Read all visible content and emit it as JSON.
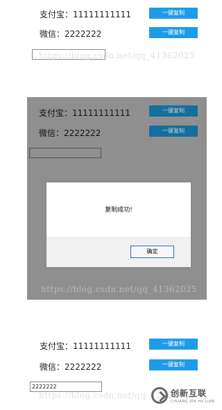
{
  "frame1": {
    "alipay_label": "支付宝：11111111111",
    "wechat_label": "微信：2222222",
    "copy_button_1": "一键复制",
    "copy_button_2": "一键复制",
    "input_value": "",
    "watermark": "https://blog.csdn.net/qq_41362025"
  },
  "frame2": {
    "alipay_label": "支付宝：11111111111",
    "wechat_label": "微信：2222222",
    "copy_button_1": "一键复制",
    "copy_button_2": "一键复制",
    "input_value": "",
    "watermark": "https://blog.csdn.net/qq_41362025",
    "dialog": {
      "message": "复制成功!",
      "ok_label": "确定"
    }
  },
  "frame3": {
    "alipay_label": "支付宝：11111111111",
    "wechat_label": "微信：2222222",
    "copy_button_1": "一键复制",
    "copy_button_2": "一键复制",
    "input_value": "2222222",
    "watermark": "https://blog.csdn.net/qq_41362025"
  },
  "logo": {
    "name_cn": "创新互联",
    "name_en": "CHUANG XIN HU LIAN",
    "icon": "x-circle-icon"
  },
  "colors": {
    "copy_button": "#1e9be8",
    "overlay": "#8f8f8f",
    "dialog_border": "#2e6eb5"
  }
}
